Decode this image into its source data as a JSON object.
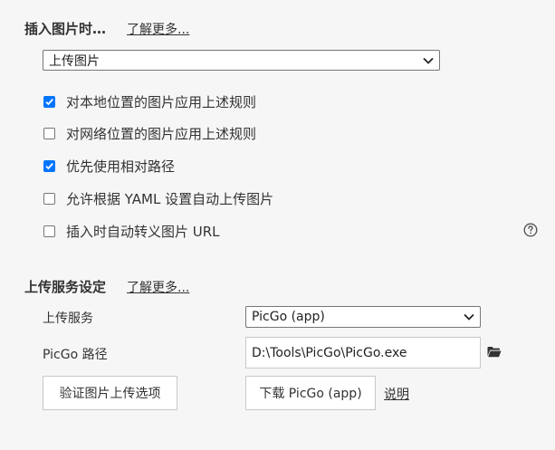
{
  "insert_section": {
    "title": "插入图片时…",
    "learn_more": "了解更多...",
    "action_select": "上传图片",
    "options": [
      {
        "label": "对本地位置的图片应用上述规则",
        "checked": true
      },
      {
        "label": "对网络位置的图片应用上述规则",
        "checked": false
      },
      {
        "label": "优先使用相对路径",
        "checked": true
      },
      {
        "label": "允许根据 YAML 设置自动上传图片",
        "checked": false
      },
      {
        "label": "插入时自动转义图片 URL",
        "checked": false
      }
    ]
  },
  "upload_section": {
    "title": "上传服务设定",
    "learn_more": "了解更多...",
    "service_label": "上传服务",
    "service_value": "PicGo (app)",
    "path_label": "PicGo 路径",
    "path_value": "D:\\Tools\\PicGo\\PicGo.exe",
    "verify_button": "验证图片上传选项",
    "download_button": "下载 PicGo (app)",
    "help_link": "说明"
  },
  "icons": {
    "help": "question-circle-icon",
    "folder": "folder-icon",
    "dropdown": "chevron-down-icon"
  },
  "colors": {
    "checkbox_checked": "#0075ff",
    "background": "#f6f6f6"
  }
}
